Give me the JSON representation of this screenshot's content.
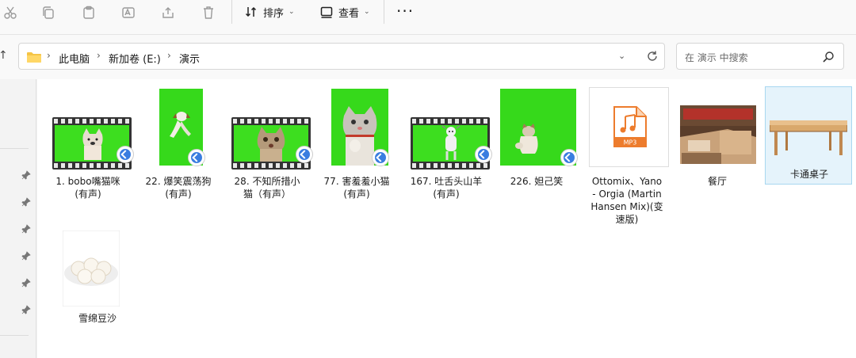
{
  "toolbar": {
    "sort_label": "排序",
    "view_label": "查看",
    "more_label": "···",
    "icons": [
      "cut-icon",
      "copy-icon",
      "paste-icon",
      "rename-icon",
      "share-icon",
      "delete-icon"
    ]
  },
  "address": {
    "breadcrumbs": [
      "此电脑",
      "新加卷 (E:)",
      "演示"
    ],
    "search_placeholder": "在 演示 中搜索"
  },
  "files": [
    {
      "name": "1.  bobo嘴猫咪\n(有声)",
      "type": "video",
      "thumb": "film-cat",
      "shortcut": true
    },
    {
      "name": "22.  爆笑震荡狗\n(有声)",
      "type": "video",
      "thumb": "green-dog",
      "shortcut": true
    },
    {
      "name": "28.  不知所措小\n猫（有声）",
      "type": "video",
      "thumb": "film-cat2",
      "shortcut": true
    },
    {
      "name": "77.  害羞羞小猫\n(有声)",
      "type": "video",
      "thumb": "green-cat",
      "shortcut": true
    },
    {
      "name": "167.  吐舌头山羊\n(有声)",
      "type": "video",
      "thumb": "film-goat",
      "shortcut": true
    },
    {
      "name": "226.  妲己笑",
      "type": "video",
      "thumb": "green-wide",
      "shortcut": true
    },
    {
      "name": "Ottomix、Yano\n- Orgia (Martin\nHansen Mix)(变\n速版)",
      "type": "audio",
      "thumb": "mp3",
      "badge": "MP3"
    },
    {
      "name": "餐厅",
      "type": "image",
      "thumb": "restaurant"
    },
    {
      "name": "卡通桌子",
      "type": "image",
      "thumb": "table",
      "selected": true
    },
    {
      "name": "雪绵豆沙",
      "type": "image",
      "thumb": "dessert"
    }
  ],
  "colors": {
    "accent": "#3a7de0",
    "green_screen": "#36d91b",
    "selected_bg": "#e5f3fb"
  }
}
